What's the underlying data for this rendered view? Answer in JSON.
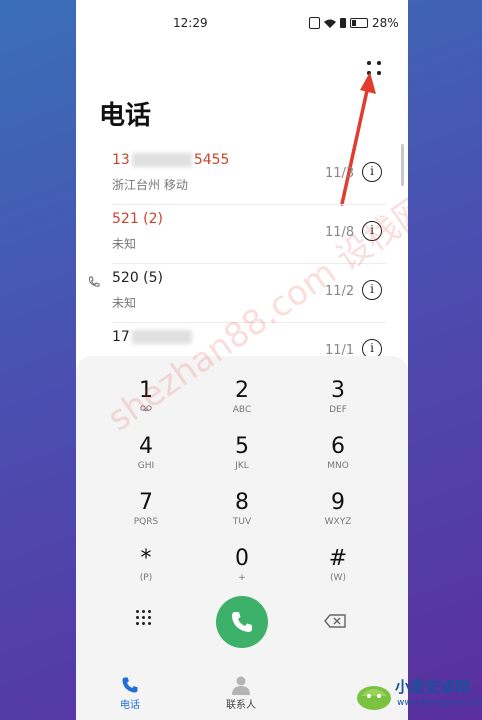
{
  "status": {
    "time": "12:29",
    "battery": "28%"
  },
  "header": {
    "title": "电话"
  },
  "calls": [
    {
      "name_start": "13",
      "name_end": "5455",
      "subtitle": "浙江台州 移动",
      "date": "11/3",
      "missed": true
    },
    {
      "name": "521 (2)",
      "subtitle": "未知",
      "date": "11/8",
      "missed": true
    },
    {
      "name": "520 (5)",
      "subtitle": "未知",
      "date": "11/2",
      "missed": false,
      "outgoing": true
    },
    {
      "name_start": "17",
      "date": "11/1",
      "missed": false
    }
  ],
  "keypad": {
    "keys": [
      {
        "digit": "1",
        "letters": ""
      },
      {
        "digit": "2",
        "letters": "ABC"
      },
      {
        "digit": "3",
        "letters": "DEF"
      },
      {
        "digit": "4",
        "letters": "GHI"
      },
      {
        "digit": "5",
        "letters": "JKL"
      },
      {
        "digit": "6",
        "letters": "MNO"
      },
      {
        "digit": "7",
        "letters": "PQRS"
      },
      {
        "digit": "8",
        "letters": "TUV"
      },
      {
        "digit": "9",
        "letters": "WXYZ"
      },
      {
        "digit": "*",
        "letters": "(P)"
      },
      {
        "digit": "0",
        "letters": "+"
      },
      {
        "digit": "#",
        "letters": "(W)"
      }
    ]
  },
  "bottom_nav": [
    {
      "label": "电话",
      "icon": "phone-icon",
      "active": true
    },
    {
      "label": "联系人",
      "icon": "contacts-icon",
      "active": false
    }
  ],
  "watermark": "shezhan88.com 设栈网",
  "logo": {
    "name": "小麦安卓网",
    "url": "www.xmsigma.com"
  },
  "colors": {
    "missed": "#c8442f",
    "call_green": "#3db069",
    "active_nav": "#1f6fd6"
  }
}
